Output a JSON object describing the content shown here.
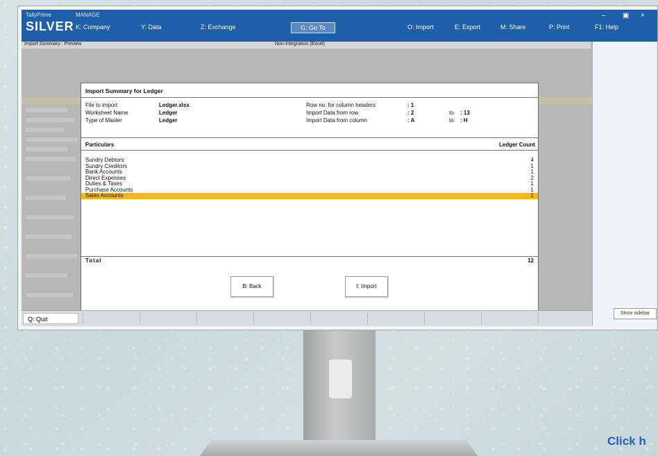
{
  "app": {
    "brand_small": "TallyPrime",
    "edition": "SILVER",
    "manager_label": "MANAGE",
    "menu": [
      {
        "key": "company",
        "label": "K: Company"
      },
      {
        "key": "data",
        "label": "Y: Data"
      },
      {
        "key": "exchange",
        "label": "Z: Exchange"
      },
      {
        "key": "goto",
        "label": "G: Go To"
      },
      {
        "key": "import",
        "label": "O: Import"
      },
      {
        "key": "export",
        "label": "E: Export"
      },
      {
        "key": "share",
        "label": "M: Share"
      },
      {
        "key": "print",
        "label": "P: Print"
      },
      {
        "key": "help",
        "label": "F1: Help"
      }
    ],
    "subbar_left": "Import Summary : Preview",
    "subbar_center": "Non-Integration (Excel)"
  },
  "dialog": {
    "title": "Import Summary for Ledger",
    "file_label": "File to import",
    "file_value": "Ledger.xlsx",
    "worksheet_label": "Worksheet Name",
    "worksheet_value": "Ledger",
    "master_label": "Type of Master",
    "master_value": "Ledger",
    "header_row_label": "Row no. for column headers",
    "header_row_value": ": 1",
    "row_label": "Import Data from row",
    "row_from": ": 2",
    "row_to_label": "to",
    "row_to": ": 13",
    "col_label": "Import Data from column",
    "col_from": ": A",
    "col_to_label": "to",
    "col_to": ": H",
    "col_particulars": "Particulars",
    "col_count": "Ledger Count",
    "rows": [
      {
        "name": "Sundry Debtors",
        "count": "4"
      },
      {
        "name": "Sundry Creditors",
        "count": "1"
      },
      {
        "name": "Bank Accounts",
        "count": "1"
      },
      {
        "name": "Direct Expenses",
        "count": "2"
      },
      {
        "name": "Duties & Taxes",
        "count": "1"
      },
      {
        "name": "Purchase Accounts",
        "count": "1"
      },
      {
        "name": "Sales Accounts",
        "count": "1"
      }
    ],
    "selected_row": 6,
    "total_label": "Total",
    "total_value": "12",
    "back_label": "B: Back",
    "import_label": "I: Import"
  },
  "bottom": {
    "quit_label": "Q: Quit"
  },
  "right_panel": {
    "button_label": "Show sidebar"
  },
  "overlay_text": "Click h",
  "colors": {
    "topbar": "#1d5fa8",
    "selection": "#f5b61e",
    "link": "#1f5ec9"
  }
}
